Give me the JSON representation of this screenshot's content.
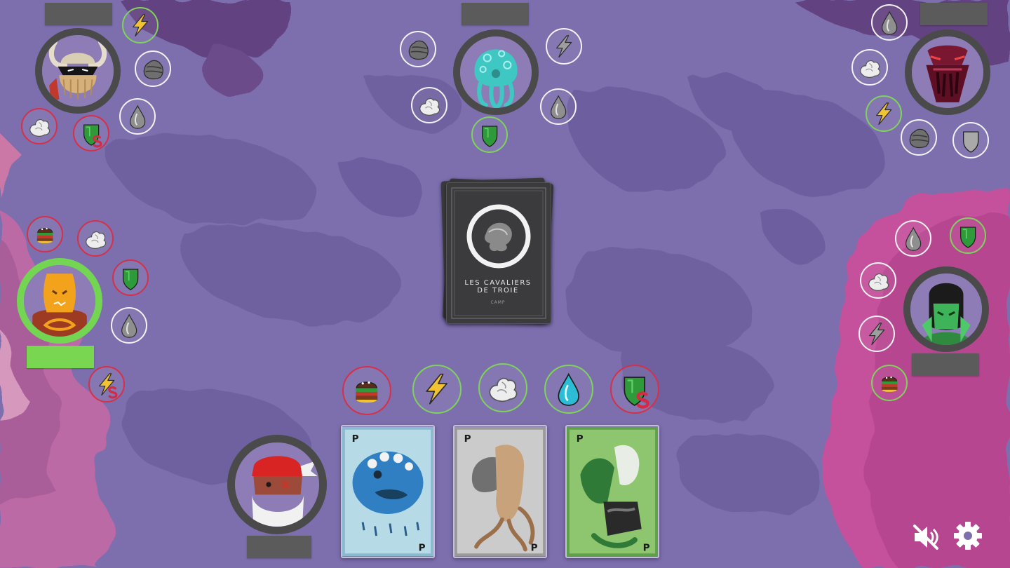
{
  "game": {
    "deck": {
      "title": "LES CAVALIERS\nDE TROIE",
      "subtitle": "CAMP"
    },
    "players": [
      {
        "id": "viking",
        "position": "top-left",
        "active": false,
        "tokens": [
          "lightning",
          "rock",
          "ghost",
          "shield-s",
          "water"
        ]
      },
      {
        "id": "octopus",
        "position": "top-center",
        "active": false,
        "tokens": [
          "rock",
          "lightning",
          "ghost",
          "water",
          "shield"
        ]
      },
      {
        "id": "demon",
        "position": "top-right",
        "active": false,
        "tokens": [
          "water",
          "ghost",
          "lightning",
          "rock",
          "shield"
        ]
      },
      {
        "id": "robot",
        "position": "left",
        "active": true,
        "tokens": [
          "burger",
          "ghost",
          "shield",
          "water",
          "lightning-s"
        ]
      },
      {
        "id": "knight",
        "position": "right",
        "active": false,
        "tokens": [
          "water",
          "shield",
          "ghost",
          "lightning",
          "burger"
        ]
      },
      {
        "id": "ninja",
        "position": "bottom",
        "active": false,
        "self": true,
        "tokens": [
          "burger",
          "lightning",
          "ghost",
          "water",
          "shield-s"
        ]
      }
    ],
    "hand": [
      {
        "name": "pufferfish-card",
        "corner": "P"
      },
      {
        "name": "frog-creature-card",
        "corner": "P"
      },
      {
        "name": "lizard-rider-card",
        "corner": "P"
      }
    ]
  },
  "controls": {
    "mute": "muted",
    "settings": "settings"
  }
}
